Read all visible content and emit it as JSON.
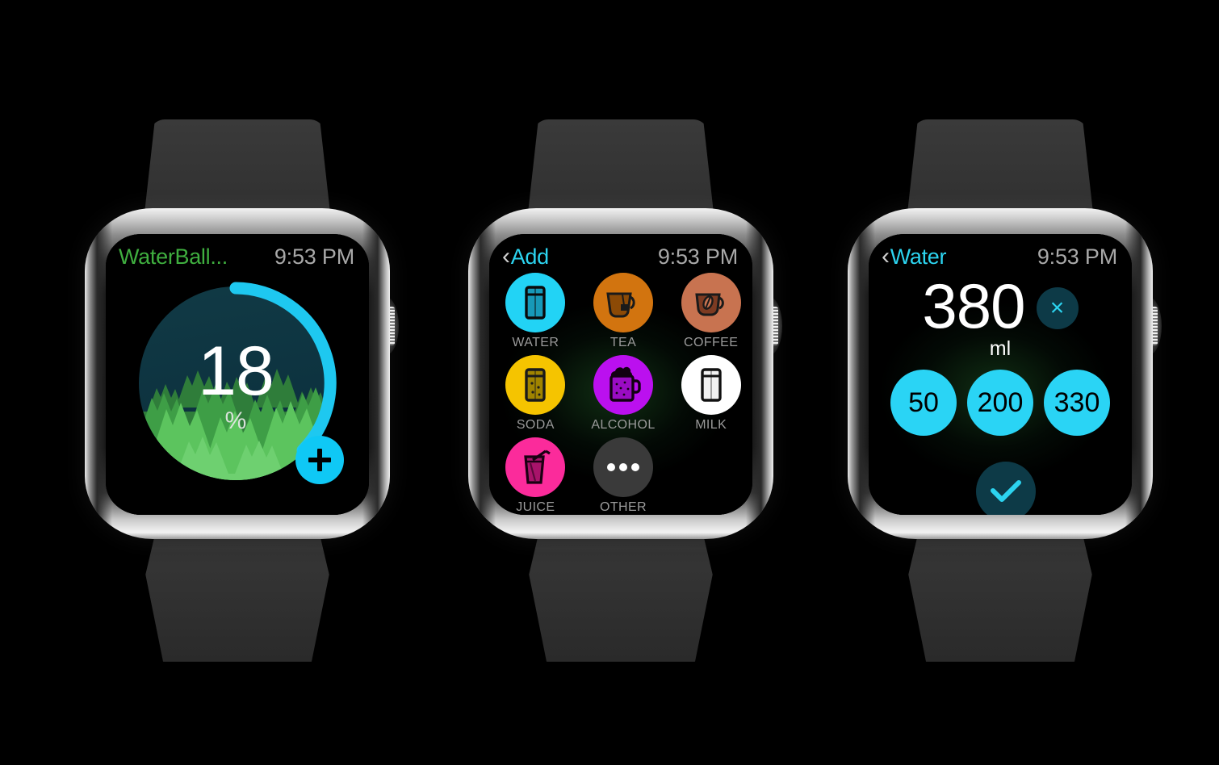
{
  "watches": [
    {
      "id": "progress",
      "statusbar": {
        "title": "WaterBall...",
        "time": "9:53 PM",
        "title_color": "#3fae3f",
        "has_back": false
      },
      "progress": {
        "value": "18",
        "unit": "%",
        "percent": 18,
        "arc_color": "#1ec8f0",
        "ball_color": "#0d3340",
        "forest_color": "#4caf50"
      },
      "add_button": {
        "name": "add-entry",
        "glyph": "+",
        "color": "#0fc8f5"
      }
    },
    {
      "id": "add",
      "statusbar": {
        "title": "Add",
        "time": "9:53 PM",
        "title_color": "#2cd4f0",
        "has_back": true,
        "back_glyph": "‹"
      },
      "drinks": [
        {
          "label": "WATER",
          "icon": "water-glass-icon",
          "color": "#22d3f5",
          "icon_color": "#0a0a0a"
        },
        {
          "label": "TEA",
          "icon": "tea-cup-icon",
          "color": "#d2740f",
          "icon_color": "#1a1a1a"
        },
        {
          "label": "COFFEE",
          "icon": "coffee-cup-icon",
          "color": "#c87350",
          "icon_color": "#1a1a1a"
        },
        {
          "label": "SODA",
          "icon": "soda-glass-icon",
          "color": "#f5c400",
          "icon_color": "#1a1a1a"
        },
        {
          "label": "ALCOHOL",
          "icon": "beer-mug-icon",
          "color": "#bb10ef",
          "icon_color": "#120012"
        },
        {
          "label": "MILK",
          "icon": "milk-glass-icon",
          "color": "#ffffff",
          "icon_color": "#111111"
        },
        {
          "label": "JUICE",
          "icon": "juice-glass-icon",
          "color": "#fb2b9b",
          "icon_color": "#1a0012"
        },
        {
          "label": "OTHER",
          "icon": "ellipsis-icon",
          "color": "#3a3a3a",
          "icon_color": "#ffffff"
        }
      ]
    },
    {
      "id": "quantity",
      "statusbar": {
        "title": "Water",
        "time": "9:53 PM",
        "title_color": "#2cd4f0",
        "has_back": true,
        "back_glyph": "‹"
      },
      "amount": {
        "value": "380",
        "unit": "ml"
      },
      "clear_button": {
        "name": "clear-amount",
        "glyph": "×",
        "color": "#0d3a47"
      },
      "presets": [
        {
          "label": "50",
          "color": "#2ad4f5"
        },
        {
          "label": "200",
          "color": "#2ad4f5"
        },
        {
          "label": "330",
          "color": "#2ad4f5"
        }
      ],
      "confirm_button": {
        "name": "confirm",
        "icon": "check-icon",
        "color": "#0d3a47",
        "check_color": "#2cd4f0"
      }
    }
  ]
}
